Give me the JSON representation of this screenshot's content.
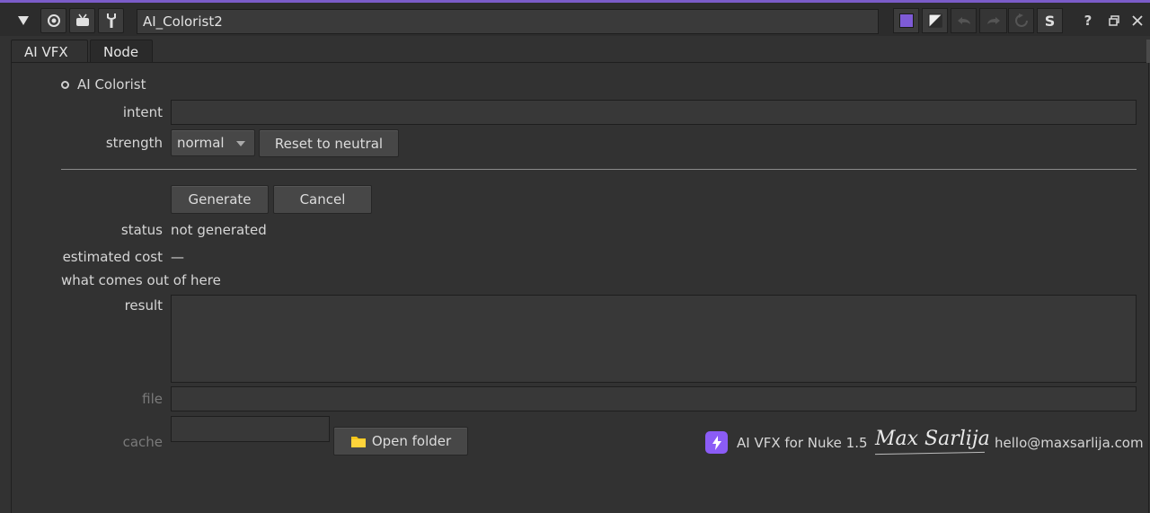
{
  "node": {
    "name": "AI_Colorist2"
  },
  "tabs": [
    {
      "label": "AI VFX"
    },
    {
      "label": "Node"
    }
  ],
  "section": {
    "title": "AI Colorist"
  },
  "fields": {
    "intent_label": "intent",
    "intent_value": "",
    "strength_label": "strength",
    "strength_value": "normal",
    "reset_label": "Reset to neutral"
  },
  "actions": {
    "generate_label": "Generate",
    "cancel_label": "Cancel"
  },
  "status": {
    "status_label": "status",
    "status_value": "not generated",
    "cost_label": "estimated cost",
    "cost_value": "—",
    "output_note": "what comes out of here"
  },
  "output": {
    "result_label": "result",
    "file_label": "file",
    "cache_label": "cache",
    "open_folder_label": "Open folder"
  },
  "footer": {
    "product": "AI VFX for Nuke 1.5",
    "author_signature": "Max Sarlija",
    "email": "hello@maxsarlija.com"
  },
  "colors": {
    "accent": "#7b5cc9",
    "node_color_swatch": "#7e5bd6",
    "product_badge": "#8b5cf6",
    "folder_icon": "#f5c518"
  },
  "icons": {
    "collapse": "triangle-down-icon",
    "viewer": "circle-target-icon",
    "tv": "tv-icon",
    "wrench": "wrench-icon",
    "bolt": "lightning-icon",
    "folder": "folder-icon"
  }
}
